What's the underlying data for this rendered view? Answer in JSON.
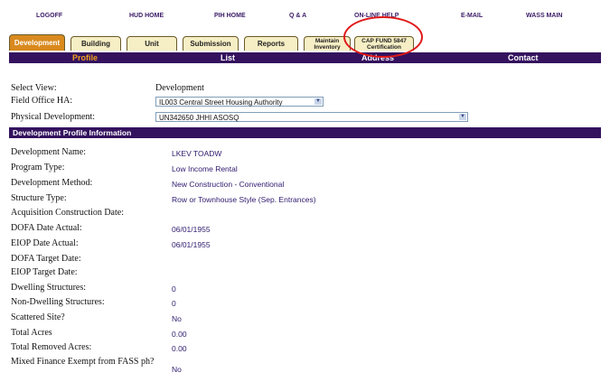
{
  "top_links": [
    "LOGOFF",
    "HUD HOME",
    "PIH HOME",
    "Q & A",
    "ON-LINE HELP",
    "E-MAIL",
    "WASS MAIN"
  ],
  "tabs": [
    {
      "label": "Development",
      "active": true
    },
    {
      "label": "Building",
      "active": false
    },
    {
      "label": "Unit",
      "active": false
    },
    {
      "label": "Submission",
      "active": false
    },
    {
      "label": "Reports",
      "active": false
    },
    {
      "label": "Maintain Inventory",
      "active": false
    },
    {
      "label": "CAP FUND 5847 Certification",
      "active": false
    }
  ],
  "subtabs": [
    {
      "label": "Profile",
      "active": true
    },
    {
      "label": "List",
      "active": false
    },
    {
      "label": "Address",
      "active": false
    },
    {
      "label": "Contact",
      "active": false
    }
  ],
  "highlight_color": "#e01818",
  "accent_color": "#34125e",
  "active_tab_color": "#d98a1e",
  "form": {
    "select_view_label": "Select View:",
    "select_view_value": "Development",
    "field_office_label": "Field Office HA:",
    "field_office_value": "IL003 Central Street Housing Authority",
    "physical_dev_label": "Physical Development:",
    "physical_dev_value": "UN342650 JHHI ASOSQ"
  },
  "section_title": "Development Profile Information",
  "profile": [
    {
      "label": "Development Name:",
      "value": "LKEV TOADW"
    },
    {
      "label": "Program Type:",
      "value": "Low Income Rental"
    },
    {
      "label": "Development Method:",
      "value": "New Construction - Conventional"
    },
    {
      "label": "Structure Type:",
      "value": "Row or Townhouse Style (Sep. Entrances)"
    },
    {
      "label": "Acquisition Construction Date:",
      "value": ""
    },
    {
      "label": "DOFA Date Actual:",
      "value": "06/01/1955"
    },
    {
      "label": "EIOP Date Actual:",
      "value": "06/01/1955"
    },
    {
      "label": "DOFA Target Date:",
      "value": ""
    },
    {
      "label": "EIOP Target Date:",
      "value": ""
    },
    {
      "label": "Dwelling Structures:",
      "value": "0"
    },
    {
      "label": "Non-Dwelling Structures:",
      "value": "0"
    },
    {
      "label": "Scattered Site?",
      "value": "No"
    },
    {
      "label": "Total Acres",
      "value": "0.00"
    },
    {
      "label": "Total Removed Acres:",
      "value": "0.00"
    },
    {
      "label": "Mixed Finance Exempt from FASS ph?",
      "value": "No"
    }
  ]
}
